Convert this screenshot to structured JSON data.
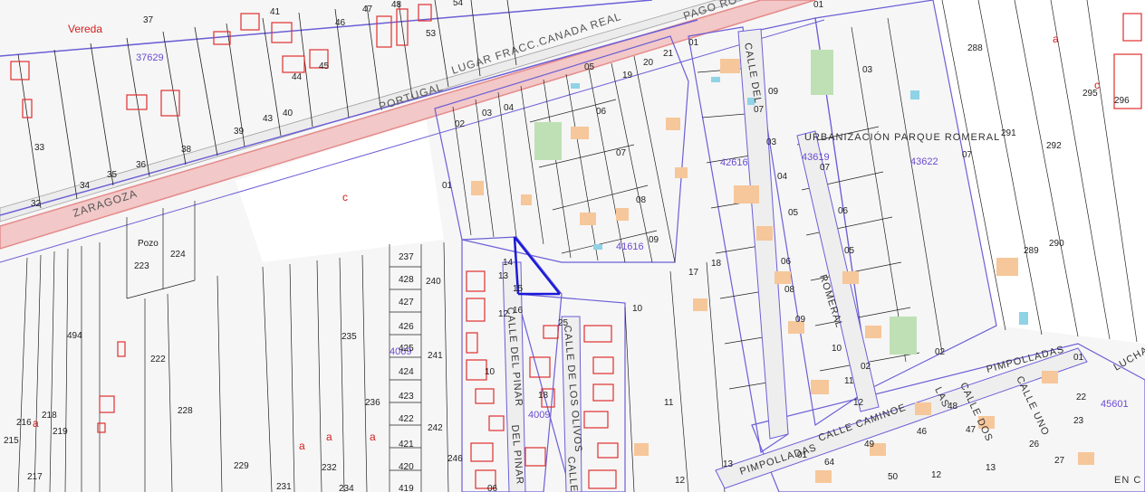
{
  "map": {
    "colors": {
      "background": "#f4f4f4",
      "road_band": "#f2c8c8",
      "road_edge": "#e58a8a",
      "parcel_line": "#222222",
      "block_line": "#6c5fd6",
      "building_red": "#e03030",
      "building_orange": "#f6c79a",
      "green": "#bfe0b4",
      "pool": "#8fd3e6"
    },
    "labels": {
      "roads": {
        "zaragoza": "ZARAGOZA",
        "portugal": "PORTUGAL",
        "lugar": "LUGAR FRACC.CANADA REAL",
        "pago": "PAGO RO",
        "urbanizacion": "URBANIZACIÓN PARQUE ROMERAL",
        "pimpolladas_1": "PIMPOLLADAS",
        "pimpolladas_2": "PIMPOLLADAS",
        "calle_caminoe": "CALLE CAMINOE",
        "las": "LAS",
        "calle_dos": "CALLE DOS",
        "calle_uno": "CALLE UNO",
        "calle_del_romeral": "CALLE DEL",
        "romeral": "ROMERAL",
        "calle_del_pinar": "CALLE DEL PINAR",
        "calle_de_los_olivos": "CALLE DE LOS OLIVOS",
        "calle_bottom": "CALLE",
        "del_pinar_bottom": "DEL PINAR",
        "calle_top": "CALLE",
        "en_c": "EN C",
        "lucha": "LUCHA",
        "pozo": "Pozo",
        "vereda": "Vereda"
      },
      "blocks": {
        "b37629": "37629",
        "b42616": "42616",
        "b43619": "43619",
        "b43622": "43622",
        "b41616": "41616",
        "b45601": "45601",
        "b4009": "4009",
        "b4069": "4069"
      },
      "parcels": {
        "p37": "37",
        "p41": "41",
        "p46": "46",
        "p47": "47",
        "p48": "48",
        "p53": "53",
        "p54": "54",
        "p44": "44",
        "p45": "45",
        "p43": "43",
        "p40": "40",
        "p38": "38",
        "p39": "39",
        "p36": "36",
        "p35": "35",
        "p34": "34",
        "p33": "33",
        "p32": "32",
        "p01a": "01",
        "p01b": "01",
        "p01c": "01",
        "p02a": "02",
        "p03a": "03",
        "p04a": "04",
        "p05a": "05",
        "p06a": "06",
        "p07a": "07",
        "p08a": "08",
        "p09a": "09",
        "p10a": "10",
        "p11a": "11",
        "p12a": "12",
        "p13a": "13",
        "p17": "17",
        "p18": "18",
        "p19": "19",
        "p20": "20",
        "p21": "21",
        "p288": "288",
        "p289": "289",
        "p290": "290",
        "p291": "291",
        "p292": "292",
        "p295": "295",
        "p296": "296",
        "p223": "223",
        "p224": "224",
        "p222": "222",
        "p228": "228",
        "p229": "229",
        "p231": "231",
        "p232": "232",
        "p234": "234",
        "p235": "235",
        "p236": "236",
        "p237": "237",
        "p428": "428",
        "p427": "427",
        "p426": "426",
        "p425": "425",
        "p424": "424",
        "p423": "423",
        "p422": "422",
        "p421": "421",
        "p420": "420",
        "p419": "419",
        "p240": "240",
        "p241": "241",
        "p242": "242",
        "p246": "246",
        "p494": "494",
        "p215": "215",
        "p216": "216",
        "p217": "217",
        "p218": "218",
        "p219": "219",
        "p05b": "05",
        "p06b": "06",
        "p07b": "07",
        "p08b": "08",
        "p09b": "09",
        "p03b": "03",
        "p04b": "04",
        "p05c": "05",
        "p06c": "06",
        "p07c": "07",
        "p08c": "08",
        "p09c": "09",
        "p10b": "10",
        "p11b": "11",
        "p12b": "12",
        "p02b": "02",
        "p03c": "03",
        "p02c": "02",
        "p14": "14",
        "p15": "15",
        "p16": "16",
        "p13b": "13",
        "p12c": "12",
        "p10c": "10",
        "p18b": "18",
        "p25": "25",
        "p06d": "06",
        "p48b": "48",
        "p47b": "47",
        "p46b": "46",
        "p49": "49",
        "p50": "50",
        "p64": "64",
        "p27": "27",
        "p26": "26",
        "p23": "23",
        "p22": "22",
        "p12d": "12",
        "p13c": "13",
        "p01d": "01",
        "p01e": "01"
      },
      "marks": {
        "a1": "a",
        "a2": "a",
        "a3": "a",
        "a4": "a",
        "a5": "a",
        "c1": "c",
        "c2": "c"
      }
    }
  }
}
